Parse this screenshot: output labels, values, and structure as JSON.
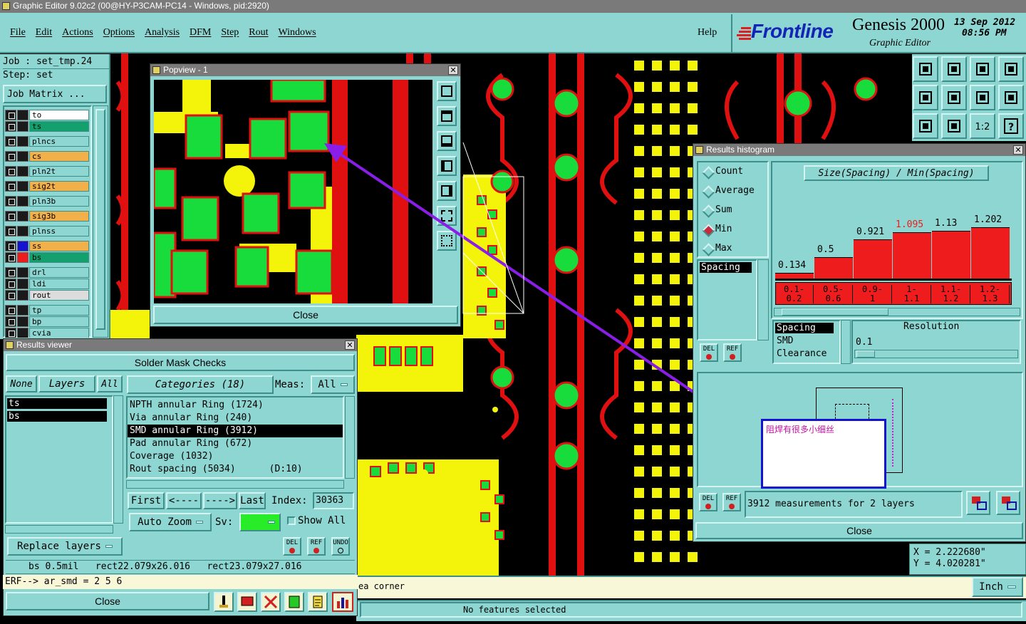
{
  "window": {
    "title": "Graphic Editor 9.02c2 (00@HY-P3CAM-PC14 - Windows, pid:2920)"
  },
  "menu": {
    "items": [
      "File",
      "Edit",
      "Actions",
      "Options",
      "Analysis",
      "DFM",
      "Step",
      "Rout",
      "Windows"
    ],
    "help": "Help"
  },
  "brand": {
    "logo": "Frontline",
    "product": "Genesis 2000",
    "subtitle": "Graphic Editor",
    "date": "13  Sep  2012",
    "time": "08:56  PM"
  },
  "job": {
    "job_label": "Job  :  set_tmp.24",
    "step_label": "Step:  set",
    "matrix_button": "Job Matrix ..."
  },
  "layers": [
    {
      "name": "to",
      "color": "#ffffff"
    },
    {
      "name": "ts",
      "color": "#14a06c"
    },
    {
      "name": "plncs",
      "color": "#8ed6d2"
    },
    {
      "name": "cs",
      "color": "#f2b04a"
    },
    {
      "name": "pln2t",
      "color": "#8ed6d2"
    },
    {
      "name": "sig2t",
      "color": "#f2b04a"
    },
    {
      "name": "pln3b",
      "color": "#8ed6d2"
    },
    {
      "name": "sig3b",
      "color": "#f2b04a"
    },
    {
      "name": "plnss",
      "color": "#8ed6d2"
    },
    {
      "name": "ss",
      "color": "#f2b04a"
    },
    {
      "name": "bs",
      "color": "#14a06c"
    },
    {
      "name": "drl",
      "color": "#8ed6d2"
    },
    {
      "name": "ldi",
      "color": "#8ed6d2"
    },
    {
      "name": "rout",
      "color": "#dcdcdc"
    },
    {
      "name": "tp",
      "color": "#8ed6d2"
    },
    {
      "name": "bp",
      "color": "#8ed6d2"
    },
    {
      "name": "cvia",
      "color": "#8ed6d2"
    }
  ],
  "popview": {
    "title": "Popview - 1",
    "close": "Close"
  },
  "histogram": {
    "title": "Results histogram",
    "modes": [
      "Count",
      "Average",
      "Sum",
      "Min",
      "Max"
    ],
    "selected_mode": "Min",
    "chart_title": "Size(Spacing) / Min(Spacing)",
    "list_left": [
      "Spacing"
    ],
    "list_right": [
      "Spacing",
      "SMD",
      "Clearance"
    ],
    "resolution_label": "Resolution",
    "resolution_value": "0.1",
    "annotation": "阻焊有很多小细丝",
    "measurements": "3912 measurements for 2 layers",
    "close": "Close"
  },
  "chart_data": {
    "type": "bar",
    "title": "Size(Spacing) / Min(Spacing)",
    "categories": [
      "0.1-\n0.2",
      "0.5-\n0.6",
      "0.9-\n1",
      "1-\n1.1",
      "1.1-\n1.2",
      "1.2-\n1.3"
    ],
    "values": [
      0.134,
      0.5,
      0.921,
      1.095,
      1.13,
      1.202
    ],
    "value_labels": [
      "0.134",
      "0.5",
      "0.921",
      "1.095",
      "1.13",
      "1.202"
    ],
    "highlight_index": 3,
    "ylim": [
      0,
      1.3
    ],
    "bar_color": "#ee1c1c"
  },
  "results": {
    "title": "Results viewer",
    "header": "Solder Mask Checks",
    "none": "None",
    "layers": "Layers",
    "all": "All",
    "categories_label": "Categories (18)",
    "meas_label": "Meas:",
    "meas_value": "All",
    "layer_list": [
      "ts",
      "bs"
    ],
    "categories": [
      "NPTH annular Ring (1724)",
      "Via annular Ring (240)",
      "SMD annular Ring (3912)",
      "Pad annular Ring (672)",
      "Coverage (1032)",
      "Rout spacing (5034)      (D:10)"
    ],
    "selected_category": 2,
    "first": "First",
    "prev": "<----",
    "next": "---->",
    "last": "Last",
    "index_label": "Index:",
    "index_value": "30363",
    "auto_zoom": "Auto Zoom",
    "sv_label": "Sv:",
    "show_all": "Show All",
    "replace_layers": "Replace layers",
    "status": "bs 0.5mil   rect22.079x26.016   rect23.079x27.016",
    "erf": "ERF--> ar_smd = 2 5 6",
    "close": "Close"
  },
  "coords": {
    "x": "X = 2.222680\"",
    "y": "Y = 4.020281\""
  },
  "bottom": {
    "prompt": "ea corner",
    "units": "Inch",
    "status": "No features selected"
  }
}
